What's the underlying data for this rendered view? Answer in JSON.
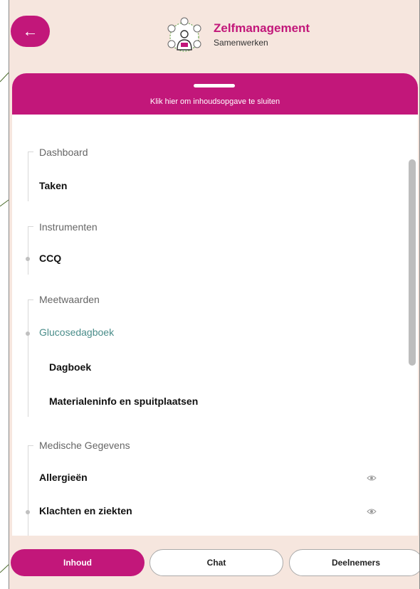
{
  "header": {
    "back_icon": "arrow-left-icon",
    "back_glyph": "←",
    "title": "Zelfmanagement",
    "subtitle": "Samenwerken",
    "emblem_icon": "collaboration-person-icon"
  },
  "panel": {
    "close_label": "Klik hier om inhoudsopgave te sluiten"
  },
  "toc": {
    "sections": [
      {
        "label": "Dashboard",
        "items": [
          {
            "label": "Taken"
          }
        ]
      },
      {
        "label": "Instrumenten",
        "items": [
          {
            "label": "CCQ"
          }
        ]
      },
      {
        "label": "Meetwaarden",
        "items": [
          {
            "label": "Glucosedagboek",
            "state": "active"
          },
          {
            "label": "Dagboek"
          },
          {
            "label": "Materialeninfo en spuitplaatsen"
          }
        ]
      },
      {
        "label": "Medische Gegevens",
        "items": [
          {
            "label": "Allergieën",
            "icon": "eye-icon"
          },
          {
            "label": "Klachten en ziekten",
            "icon": "eye-icon"
          }
        ]
      }
    ]
  },
  "tabs": [
    {
      "label": "Inhoud",
      "active": true
    },
    {
      "label": "Chat",
      "active": false
    },
    {
      "label": "Deelnemers",
      "active": false
    }
  ],
  "colors": {
    "brand": "#c2177a",
    "background": "#f6e6de",
    "active_item": "#4a8d8a"
  }
}
